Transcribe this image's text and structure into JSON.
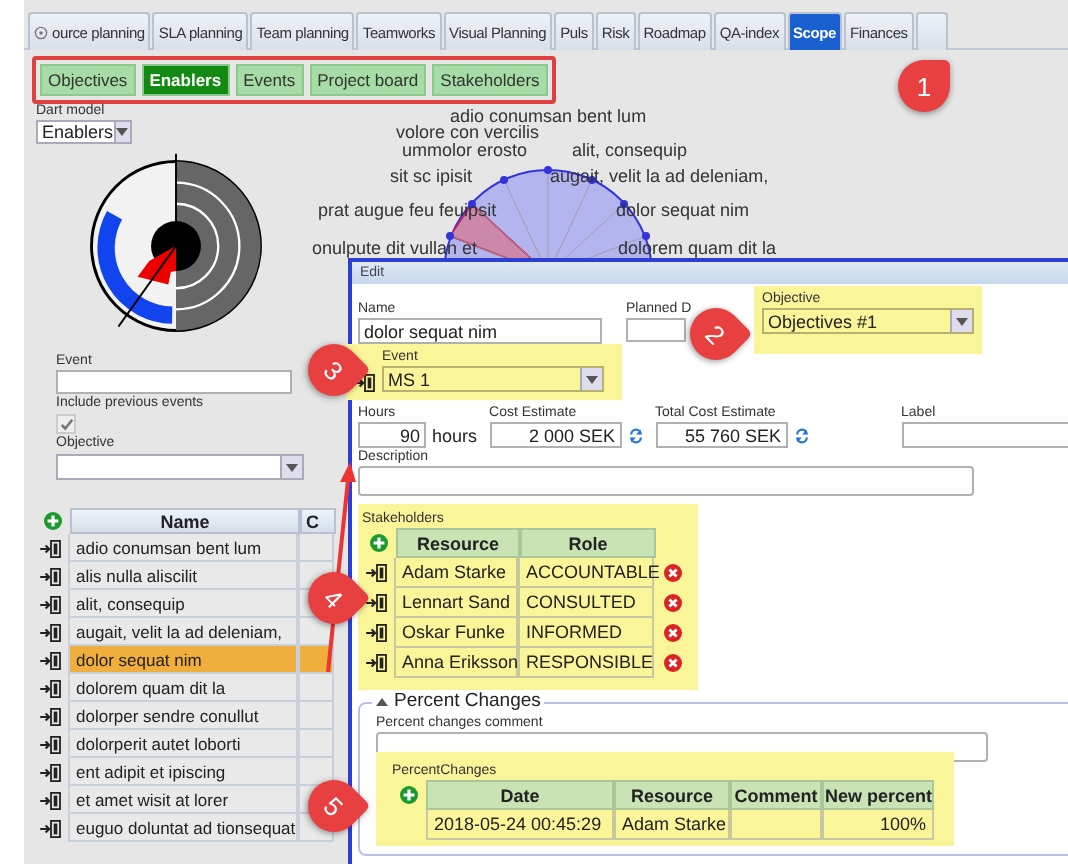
{
  "tabs": [
    {
      "label": "ource planning",
      "selected": false,
      "icon": true
    },
    {
      "label": "SLA planning",
      "selected": false
    },
    {
      "label": "Team planning",
      "selected": false
    },
    {
      "label": "Teamworks",
      "selected": false
    },
    {
      "label": "Visual Planning",
      "selected": false
    },
    {
      "label": "Puls",
      "selected": false
    },
    {
      "label": "Risk",
      "selected": false
    },
    {
      "label": "Roadmap",
      "selected": false
    },
    {
      "label": "QA-index",
      "selected": false
    },
    {
      "label": "Scope",
      "selected": true
    },
    {
      "label": "Finances",
      "selected": false
    }
  ],
  "subtabs": [
    {
      "label": "Objectives",
      "selected": false
    },
    {
      "label": "Enablers",
      "selected": true
    },
    {
      "label": "Events",
      "selected": false
    },
    {
      "label": "Project board",
      "selected": false
    },
    {
      "label": "Stakeholders",
      "selected": false
    }
  ],
  "dart_model": {
    "label": "Dart model",
    "value": "Enablers"
  },
  "radar_labels": [
    "adio conumsan bent lum",
    "volore con vercilis",
    "ummolor erosto",
    "alit, consequip",
    "sit sc ipisit",
    "augait, velit la ad deleniam,",
    "prat augue feu feuipsit",
    "dolor sequat nim",
    "onulpute dit vullan et",
    "dolorem quam dit la"
  ],
  "filters": {
    "event_label": "Event",
    "include_label": "Include previous events",
    "include_checked": true,
    "include_disabled": true,
    "objective_label": "Objective"
  },
  "list": {
    "columns": [
      "Name",
      "C"
    ],
    "rows": [
      {
        "name": "adio conumsan bent lum",
        "selected": false
      },
      {
        "name": "alis nulla aliscilit",
        "selected": false
      },
      {
        "name": "alit, consequip",
        "selected": false
      },
      {
        "name": "augait, velit la ad deleniam,",
        "selected": false
      },
      {
        "name": "dolor sequat nim",
        "selected": true
      },
      {
        "name": "dolorem quam dit la",
        "selected": false
      },
      {
        "name": "dolorper sendre conullut",
        "selected": false
      },
      {
        "name": "dolorperit autet loborti",
        "selected": false
      },
      {
        "name": "ent adipit et ipiscing",
        "selected": false
      },
      {
        "name": "et amet wisit at lorer",
        "selected": false
      },
      {
        "name": "euguo doluntat ad tionsequat",
        "selected": false
      }
    ]
  },
  "dialog": {
    "title": "Edit",
    "name": {
      "label": "Name",
      "value": "dolor sequat nim"
    },
    "planned": {
      "label": "Planned D"
    },
    "objective": {
      "label": "Objective",
      "value": "Objectives #1"
    },
    "event": {
      "label": "Event",
      "value": "MS 1"
    },
    "hours": {
      "label": "Hours",
      "value": "90",
      "unit": "hours"
    },
    "cost": {
      "label": "Cost Estimate",
      "value": "2 000 SEK"
    },
    "total": {
      "label": "Total Cost Estimate",
      "value": "55 760 SEK"
    },
    "label_field": {
      "label": "Label"
    },
    "description": {
      "label": "Description"
    },
    "stakeholders": {
      "label": "Stakeholders",
      "columns": [
        "Resource",
        "Role"
      ],
      "rows": [
        {
          "resource": "Adam Starke",
          "role": "ACCOUNTABLE"
        },
        {
          "resource": "Lennart Sand",
          "role": "CONSULTED"
        },
        {
          "resource": "Oskar Funke",
          "role": "INFORMED"
        },
        {
          "resource": "Anna Eriksson",
          "role": "RESPONSIBLE"
        }
      ]
    },
    "percent": {
      "legend": "Percent Changes",
      "expanded": true,
      "comment_label": "Percent changes comment",
      "table_label": "PercentChanges",
      "columns": [
        "Date",
        "Resource",
        "Comment",
        "New percent"
      ],
      "rows": [
        {
          "date": "2018-05-24 00:45:29",
          "resource": "Adam Starke",
          "comment": "",
          "percent": "100%"
        }
      ]
    }
  },
  "callouts": [
    "1",
    "2",
    "3",
    "4",
    "5"
  ]
}
